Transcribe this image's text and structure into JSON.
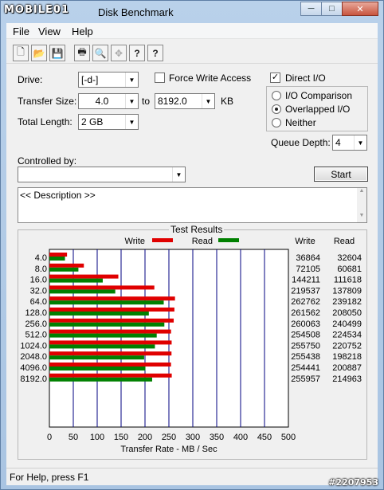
{
  "window": {
    "logo_text": "MOBILE01",
    "title": "Disk Benchmark",
    "buttons": {
      "minimize": "─",
      "maximize": "□",
      "close": "✕"
    }
  },
  "menu": {
    "file": "File",
    "view": "View",
    "help": "Help"
  },
  "toolbar": [
    {
      "name": "new-icon",
      "glyph": "🗋"
    },
    {
      "name": "open-icon",
      "glyph": "📂"
    },
    {
      "name": "save-icon",
      "glyph": "💾"
    },
    {
      "name": "print-icon",
      "glyph": "🖶"
    },
    {
      "name": "print-preview-icon",
      "glyph": "🔍"
    },
    {
      "name": "move-icon",
      "glyph": "✥"
    },
    {
      "name": "help-icon",
      "glyph": "?"
    },
    {
      "name": "context-help-icon",
      "glyph": "?"
    }
  ],
  "settings": {
    "drive_label": "Drive:",
    "drive_value": "[-d-]",
    "force_write_label": "Force Write Access",
    "direct_io_label": "Direct I/O",
    "transfer_size_label": "Transfer Size:",
    "transfer_from": "4.0",
    "to_label": "to",
    "transfer_to": "8192.0",
    "kb_label": "KB",
    "total_length_label": "Total Length:",
    "total_length_value": "2 GB",
    "io_comparison_label": "I/O Comparison",
    "overlapped_io_label": "Overlapped I/O",
    "neither_label": "Neither",
    "queue_depth_label": "Queue Depth:",
    "queue_depth_value": "4",
    "controlled_by_label": "Controlled by:",
    "controlled_by_value": "",
    "start_button": "Start",
    "description": "<< Description >>"
  },
  "results_title": "Test Results",
  "chart_data": {
    "type": "bar",
    "orientation": "horizontal",
    "categories": [
      "4.0",
      "8.0",
      "16.0",
      "32.0",
      "64.0",
      "128.0",
      "256.0",
      "512.0",
      "1024.0",
      "2048.0",
      "4096.0",
      "8192.0"
    ],
    "series": [
      {
        "name": "Write",
        "color": "#e00000",
        "values": [
          36864,
          72105,
          144211,
          219537,
          262762,
          261562,
          260063,
          254508,
          255750,
          255438,
          254441,
          255957
        ]
      },
      {
        "name": "Read",
        "color": "#008000",
        "values": [
          32604,
          60681,
          111618,
          137809,
          239182,
          208050,
          240499,
          224534,
          220752,
          198218,
          200887,
          214963
        ]
      }
    ],
    "xlabel": "Transfer Rate - MB / Sec",
    "xlim": [
      0,
      500
    ],
    "xticks": [
      "0",
      "50",
      "100",
      "150",
      "200",
      "250",
      "300",
      "350",
      "400",
      "450",
      "500"
    ],
    "column_headers": {
      "write": "Write",
      "read": "Read"
    },
    "grid": true,
    "legend": "top"
  },
  "status_text": "For Help, press F1",
  "watermark": "#2207953"
}
